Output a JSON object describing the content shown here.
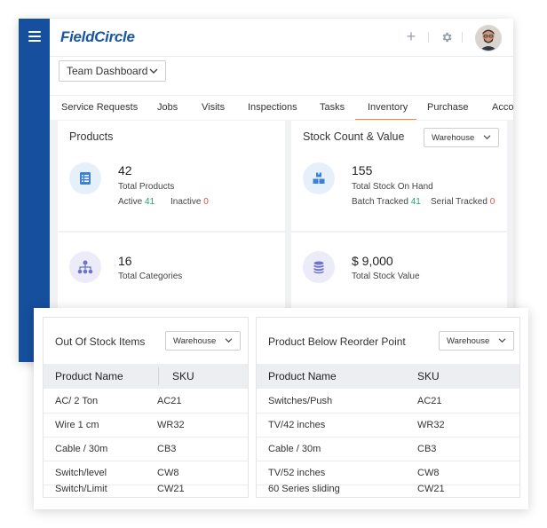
{
  "header": {
    "logo": "FieldCircle",
    "icons": [
      "menu-icon",
      "plus-icon",
      "gear-icon",
      "avatar"
    ]
  },
  "dashboard_selector": {
    "value": "Team Dashboard"
  },
  "tabs": [
    "Service Requests",
    "Jobs",
    "Visits",
    "Inspections",
    "Tasks",
    "Inventory",
    "Purchase",
    "Acco"
  ],
  "active_tab": "Inventory",
  "products_card": {
    "title": "Products",
    "total_value": "42",
    "total_label": "Total Products",
    "active_label": "Active",
    "active_value": "41",
    "inactive_label": "Inactive",
    "inactive_value": "0",
    "categories_value": "16",
    "categories_label": "Total Categories"
  },
  "stock_card": {
    "title": "Stock Count & Value",
    "filter": "Warehouse",
    "on_hand_value": "155",
    "on_hand_label": "Total Stock On Hand",
    "batch_label": "Batch Tracked",
    "batch_value": "41",
    "serial_label": "Serial Tracked",
    "serial_value": "0",
    "stock_value": "$ 9,000",
    "stock_value_label": "Total Stock Value"
  },
  "out_of_stock": {
    "title": "Out Of Stock Items",
    "filter": "Warehouse",
    "columns": [
      "Product Name",
      "SKU"
    ],
    "rows": [
      [
        "AC/ 2 Ton",
        "AC21"
      ],
      [
        "Wire 1 cm",
        "WR32"
      ],
      [
        "Cable / 30m",
        "CB3"
      ],
      [
        "Switch/level",
        "CW8"
      ],
      [
        "Switch/Limit",
        "CW21"
      ]
    ]
  },
  "below_reorder": {
    "title": "Product Below Reorder Point",
    "filter": "Warehouse",
    "columns": [
      "Product Name",
      "SKU"
    ],
    "rows": [
      [
        "Switches/Push",
        "AC21"
      ],
      [
        "TV/42 inches",
        "WR32"
      ],
      [
        "Cable / 30m",
        "CB3"
      ],
      [
        "TV/52 inches",
        "CW8"
      ],
      [
        "60 Series sliding",
        "CW21"
      ]
    ]
  },
  "colors": {
    "sidebar": "#164f9d",
    "logo": "#1a56a6",
    "accent_tab": "#ee8637",
    "active_green": "#1aa86b",
    "inactive_red": "#e74c3c"
  }
}
